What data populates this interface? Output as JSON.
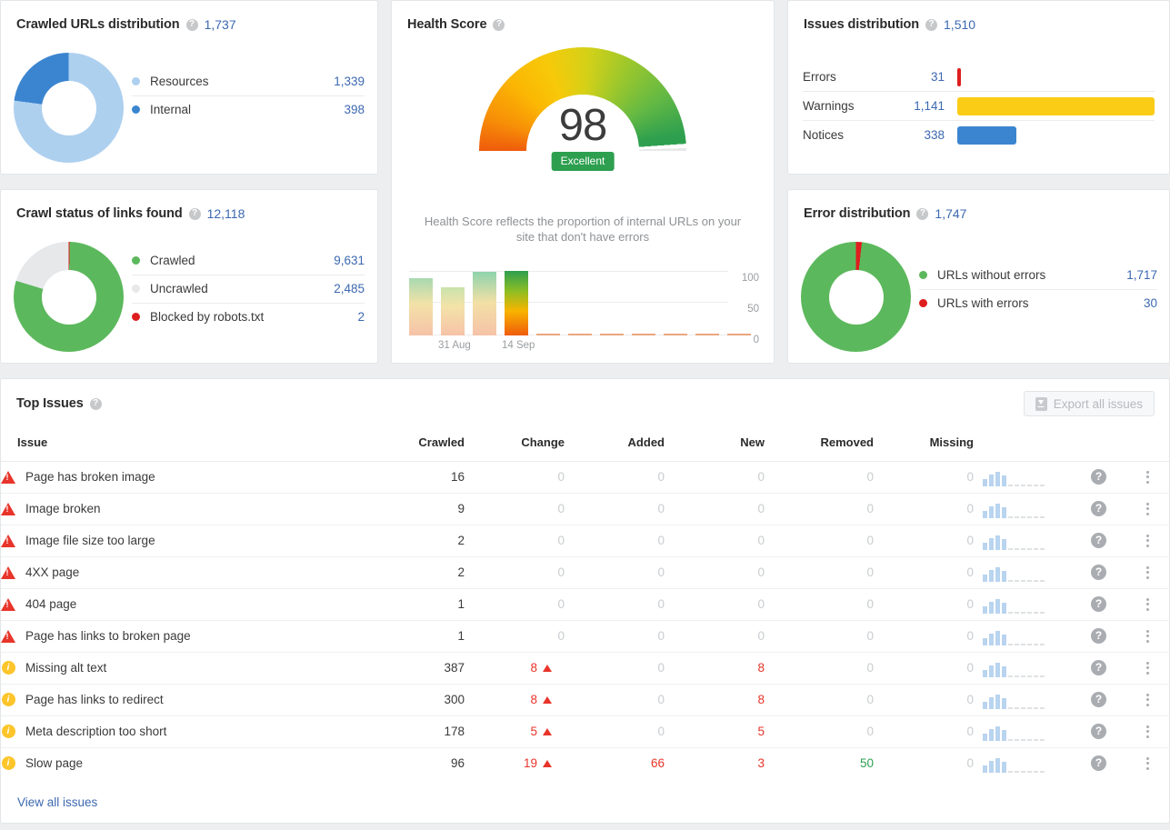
{
  "crawled_urls": {
    "title": "Crawled URLs distribution",
    "help": "?",
    "total": "1,737",
    "legend": [
      {
        "label": "Resources",
        "value": "1,339",
        "color": "#aed0ef"
      },
      {
        "label": "Internal",
        "value": "398",
        "color": "#3b85d0"
      }
    ]
  },
  "crawl_status": {
    "title": "Crawl status of links found",
    "help": "?",
    "total": "12,118",
    "legend": [
      {
        "label": "Crawled",
        "value": "9,631",
        "color": "#5cb85c"
      },
      {
        "label": "Uncrawled",
        "value": "2,485",
        "color": "#e6e8ea"
      },
      {
        "label": "Blocked by robots.txt",
        "value": "2",
        "color": "#de1e1e"
      }
    ]
  },
  "health_score": {
    "title": "Health Score",
    "help": "?",
    "value": "98",
    "badge": "Excellent",
    "description": "Health Score reflects the proportion of internal URLs on your site that don't have errors",
    "badge_color": "#2d9f4f"
  },
  "issues_distribution": {
    "title": "Issues distribution",
    "help": "?",
    "total": "1,510",
    "rows": [
      {
        "label": "Errors",
        "value": "31",
        "color": "#de1e1e",
        "pct": 2
      },
      {
        "label": "Warnings",
        "value": "1,141",
        "color": "#fbcc15",
        "pct": 100
      },
      {
        "label": "Notices",
        "value": "338",
        "color": "#3b85d0",
        "pct": 30
      }
    ]
  },
  "error_distribution": {
    "title": "Error distribution",
    "help": "?",
    "total": "1,747",
    "legend": [
      {
        "label": "URLs without errors",
        "value": "1,717",
        "color": "#5cb85c"
      },
      {
        "label": "URLs with errors",
        "value": "30",
        "color": "#de1e1e"
      }
    ]
  },
  "top_issues": {
    "title": "Top Issues",
    "help": "?",
    "export_label": "Export all issues",
    "export_icon": "download-icon",
    "view_all_label": "View all issues",
    "columns": [
      "Issue",
      "Crawled",
      "Change",
      "Added",
      "New",
      "Removed",
      "Missing"
    ],
    "rows": [
      {
        "severity": "error",
        "issue": "Page has broken image",
        "crawled": "16",
        "change": "0",
        "change_dir": "none",
        "added": "0",
        "new": "0",
        "removed": "0",
        "missing": "0"
      },
      {
        "severity": "error",
        "issue": "Image broken",
        "crawled": "9",
        "change": "0",
        "change_dir": "none",
        "added": "0",
        "new": "0",
        "removed": "0",
        "missing": "0"
      },
      {
        "severity": "error",
        "issue": "Image file size too large",
        "crawled": "2",
        "change": "0",
        "change_dir": "none",
        "added": "0",
        "new": "0",
        "removed": "0",
        "missing": "0"
      },
      {
        "severity": "error",
        "issue": "4XX page",
        "crawled": "2",
        "change": "0",
        "change_dir": "none",
        "added": "0",
        "new": "0",
        "removed": "0",
        "missing": "0"
      },
      {
        "severity": "error",
        "issue": "404 page",
        "crawled": "1",
        "change": "0",
        "change_dir": "none",
        "added": "0",
        "new": "0",
        "removed": "0",
        "missing": "0"
      },
      {
        "severity": "error",
        "issue": "Page has links to broken page",
        "crawled": "1",
        "change": "0",
        "change_dir": "none",
        "added": "0",
        "new": "0",
        "removed": "0",
        "missing": "0"
      },
      {
        "severity": "warning",
        "issue": "Missing alt text",
        "crawled": "387",
        "change": "8",
        "change_dir": "up",
        "added": "0",
        "new": "8",
        "removed": "0",
        "missing": "0"
      },
      {
        "severity": "warning",
        "issue": "Page has links to redirect",
        "crawled": "300",
        "change": "8",
        "change_dir": "up",
        "added": "0",
        "new": "8",
        "removed": "0",
        "missing": "0"
      },
      {
        "severity": "warning",
        "issue": "Meta description too short",
        "crawled": "178",
        "change": "5",
        "change_dir": "up",
        "added": "0",
        "new": "5",
        "removed": "0",
        "missing": "0"
      },
      {
        "severity": "warning",
        "issue": "Slow page",
        "crawled": "96",
        "change": "19",
        "change_dir": "up",
        "added": "66",
        "new": "3",
        "removed": "50",
        "missing": "0"
      }
    ]
  },
  "chart_data": [
    {
      "type": "pie",
      "title": "Crawled URLs distribution",
      "labels": [
        "Resources",
        "Internal"
      ],
      "values": [
        1339,
        398
      ],
      "colors": [
        "#aed0ef",
        "#3b85d0"
      ],
      "total": 1737,
      "legend": "right"
    },
    {
      "type": "pie",
      "title": "Crawl status of links found",
      "labels": [
        "Crawled",
        "Uncrawled",
        "Blocked by robots.txt"
      ],
      "values": [
        9631,
        2485,
        2
      ],
      "colors": [
        "#5cb85c",
        "#e6e8ea",
        "#de1e1e"
      ],
      "total": 12118,
      "legend": "right"
    },
    {
      "type": "bar",
      "title": "Health Score history",
      "categories": [
        "",
        "31 Aug",
        "",
        "14 Sep",
        "",
        "",
        "",
        "",
        "",
        "",
        ""
      ],
      "values": [
        90,
        75,
        98,
        100,
        0,
        0,
        0,
        0,
        0,
        0,
        0
      ],
      "ylabel": "",
      "ylim": [
        0,
        100
      ],
      "yticks": [
        0,
        50,
        100
      ],
      "xlabels_shown": [
        "31 Aug",
        "14 Sep"
      ]
    },
    {
      "type": "bar",
      "title": "Issues distribution",
      "categories": [
        "Errors",
        "Warnings",
        "Notices"
      ],
      "values": [
        31,
        1141,
        338
      ],
      "colors": [
        "#de1e1e",
        "#fbcc15",
        "#3b85d0"
      ],
      "total": 1510,
      "orientation": "horizontal"
    },
    {
      "type": "pie",
      "title": "Error distribution",
      "labels": [
        "URLs without errors",
        "URLs with errors"
      ],
      "values": [
        1717,
        30
      ],
      "colors": [
        "#5cb85c",
        "#de1e1e"
      ],
      "total": 1747,
      "legend": "right"
    }
  ]
}
